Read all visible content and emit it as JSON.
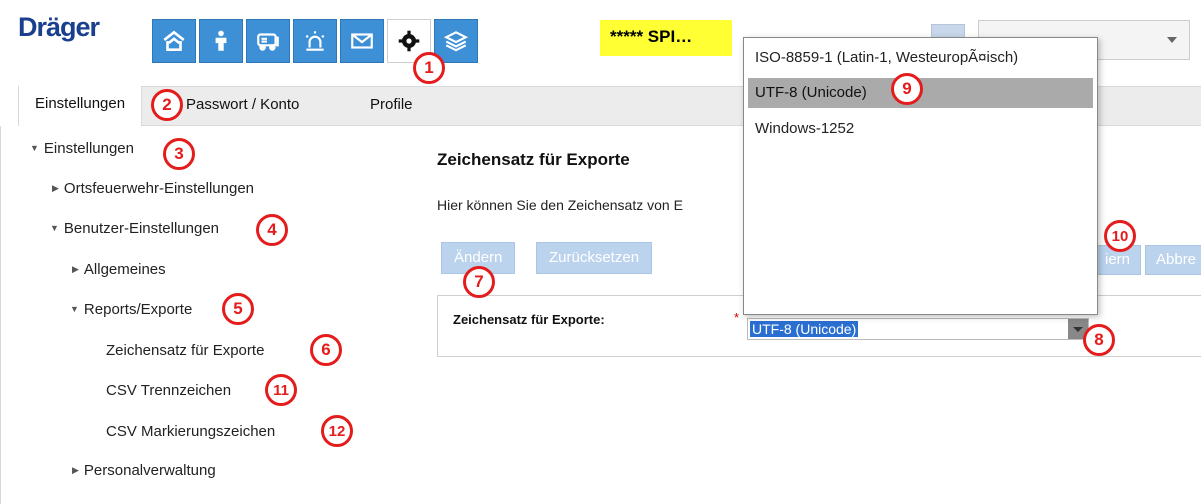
{
  "header": {
    "logo": "Dräger",
    "user_badge": "***** SPI…",
    "nav_icons": [
      "home-icon",
      "person-icon",
      "vehicle-icon",
      "alarm-icon",
      "mail-icon",
      "gear-icon",
      "layers-icon"
    ]
  },
  "tabs": [
    {
      "label": "Einstellungen"
    },
    {
      "label": "Passwort / Konto"
    },
    {
      "label": "Profile"
    }
  ],
  "tree": {
    "root": "Einstellungen",
    "ortsfeuerwehr": "Ortsfeuerwehr-Einstellungen",
    "benutzer": "Benutzer-Einstellungen",
    "allgemeines": "Allgemeines",
    "reports": "Reports/Exporte",
    "zeichensatz": "Zeichensatz für Exporte",
    "csv_trenn": "CSV Trennzeichen",
    "csv_mark": "CSV Markierungszeichen",
    "personal": "Personalverwaltung"
  },
  "content": {
    "title": "Zeichensatz für Exporte",
    "description": "Hier können Sie den Zeichensatz von E",
    "btn_change": "Ändern",
    "btn_reset": "Zurücksetzen",
    "btn_right_1": "iern",
    "btn_right_2": "Abbre",
    "field_label": "Zeichensatz für Exporte:",
    "required_mark": "*",
    "field_value": "UTF-8 (Unicode)"
  },
  "dropdown": {
    "options": [
      "ISO-8859-1 (Latin-1, WesteuropÃ¤isch)",
      "UTF-8 (Unicode)",
      "Windows-1252"
    ],
    "selected_index": 1
  },
  "markers": [
    "1",
    "2",
    "3",
    "4",
    "5",
    "6",
    "7",
    "8",
    "9",
    "10",
    "11",
    "12"
  ],
  "colors": {
    "nav_blue": "#3d8fd6",
    "badge_yellow": "#ffff33",
    "marker_red": "#e41c1c",
    "button_disabled": "#bcd3ee"
  }
}
